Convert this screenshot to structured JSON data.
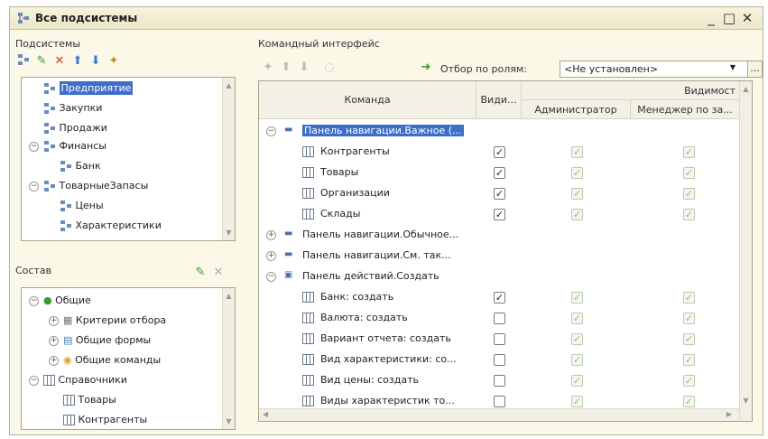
{
  "window": {
    "title": "Все подсистемы",
    "controls": [
      "_",
      "□",
      "✕"
    ]
  },
  "subsystems": {
    "label": "Подсистемы",
    "items": [
      {
        "label": "Предприятие",
        "selected": true
      },
      {
        "label": "Закупки"
      },
      {
        "label": "Продажи"
      },
      {
        "label": "Финансы",
        "expanded": true
      },
      {
        "label": "Банк"
      },
      {
        "label": "ТоварныеЗапасы",
        "expanded": true
      },
      {
        "label": "Цены"
      },
      {
        "label": "Характеристики"
      }
    ]
  },
  "composition": {
    "label": "Состав",
    "items": [
      {
        "label": "Общие"
      },
      {
        "label": "Критерии отбора"
      },
      {
        "label": "Общие формы"
      },
      {
        "label": "Общие команды"
      },
      {
        "label": "Справочники"
      },
      {
        "label": "Товары"
      },
      {
        "label": "Контрагенты"
      }
    ]
  },
  "command_interface": {
    "label": "Командный интерфейс",
    "role_filter_label": "Отбор по ролям:",
    "role_filter_value": "<Не установлен>",
    "more_button": "...",
    "columns": {
      "command": "Команда",
      "visible": "Види...",
      "visibility": "Видимост",
      "admin": "Администратор",
      "manager": "Менеджер по за..."
    },
    "rows": [
      {
        "label": "Панель навигации.Важное (...",
        "group": true,
        "expanded": true,
        "highlight": true
      },
      {
        "label": "Контрагенты",
        "visible": true,
        "admin": true,
        "manager": true
      },
      {
        "label": "Товары",
        "visible": true,
        "admin": true,
        "manager": true
      },
      {
        "label": "Организации",
        "visible": true,
        "admin": true,
        "manager": true
      },
      {
        "label": "Склады",
        "visible": true,
        "admin": true,
        "manager": true
      },
      {
        "label": "Панель навигации.Обычное...",
        "group": true,
        "expanded": false
      },
      {
        "label": "Панель навигации.См. так...",
        "group": true,
        "expanded": false
      },
      {
        "label": "Панель действий.Создать",
        "group": true,
        "expanded": true
      },
      {
        "label": "Банк: создать",
        "visible": true,
        "admin": true,
        "manager": true
      },
      {
        "label": "Валюта: создать",
        "visible": false,
        "admin": true,
        "manager": true
      },
      {
        "label": "Вариант отчета: создать",
        "visible": false,
        "admin": true,
        "manager": true
      },
      {
        "label": "Вид характеристики: со...",
        "visible": false,
        "admin": true,
        "manager": true
      },
      {
        "label": "Вид цены: создать",
        "visible": false,
        "admin": true,
        "manager": true
      },
      {
        "label": "Виды характеристик то...",
        "visible": false,
        "admin": true,
        "manager": true
      }
    ]
  },
  "colors": {
    "window_bg": "#fbf8e8",
    "selection": "#3d6fc9",
    "delete_red": "#d43c2c",
    "edit_green": "#3a9a2c",
    "arrow_blue": "#3c78d8"
  }
}
